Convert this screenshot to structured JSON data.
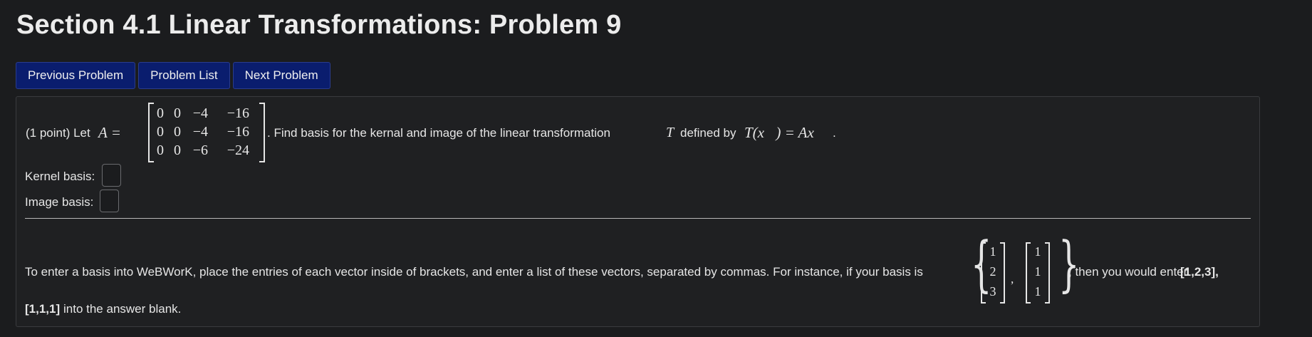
{
  "page_title": "Section 4.1 Linear Transformations: Problem 9",
  "nav": {
    "previous": "Previous Problem",
    "list": "Problem List",
    "next": "Next Problem"
  },
  "problem": {
    "intro": "(1 point) Let",
    "matrix_symbol": "A =",
    "matrix": [
      [
        "0",
        "0",
        "−4",
        "−16"
      ],
      [
        "0",
        "0",
        "−4",
        "−16"
      ],
      [
        "0",
        "0",
        "−6",
        "−24"
      ]
    ],
    "statement": ". Find basis for the kernal and image of the linear transformation",
    "t_symbol": "T",
    "defined_by": "defined by",
    "formula": "T(x⃗) = Ax⃗",
    "period": ".",
    "kernel_label": "Kernel basis:",
    "image_label": "Image basis:",
    "kernel_value": "",
    "image_value": ""
  },
  "instructions": {
    "text_before": "To enter a basis into WeBWorK, place the entries of each vector inside of brackets, and enter a list of these vectors, separated by commas. For instance, if your basis is",
    "example_vectors": [
      [
        "1",
        "2",
        "3"
      ],
      [
        "1",
        "1",
        "1"
      ]
    ],
    "comma": ",",
    "text_after": ", then you would enter",
    "bold_1": "[1,2,3],",
    "bold_2": "[1,1,1]",
    "text_end": "into the answer blank."
  }
}
